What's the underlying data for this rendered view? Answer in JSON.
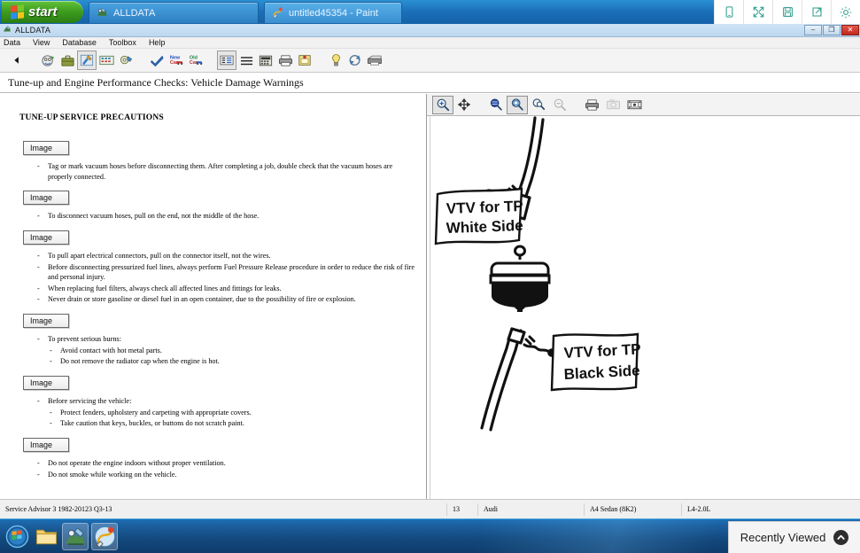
{
  "taskbar_top": {
    "start_label": "start",
    "tasks": [
      {
        "label": "ALLDATA",
        "icon": "alldata-icon"
      },
      {
        "label": "untitled45354 - Paint",
        "icon": "paint-icon"
      }
    ],
    "right_buttons": [
      {
        "name": "device-view-icon"
      },
      {
        "name": "fullscreen-icon"
      },
      {
        "name": "save-icon"
      },
      {
        "name": "share-icon"
      },
      {
        "name": "gear-icon"
      }
    ]
  },
  "app_window": {
    "title": "ALLDATA",
    "window_buttons": {
      "minimize": "–",
      "maximize": "❐",
      "close": "✕"
    },
    "menu": [
      "Data",
      "View",
      "Database",
      "Toolbox",
      "Help"
    ],
    "toolbar": [
      {
        "name": "back-arrow-icon",
        "label": "Back"
      },
      {
        "name": "vehicle-info-icon",
        "label": "Vehicle Info"
      },
      {
        "name": "briefcase-icon",
        "label": "Job"
      },
      {
        "name": "repair-tools-icon",
        "label": "Repair",
        "active": true
      },
      {
        "name": "tsb-icon",
        "label": "TSB"
      },
      {
        "name": "parts-icon",
        "label": "Parts"
      },
      {
        "name": "checkmark-icon",
        "label": "Confirm"
      },
      {
        "name": "new-car-icon",
        "label": "New Car"
      },
      {
        "name": "used-car-icon",
        "label": "Used Car"
      },
      {
        "name": "table-view-icon",
        "label": "Table View",
        "active": true
      },
      {
        "name": "list-view-icon",
        "label": "List View"
      },
      {
        "name": "calculator-icon",
        "label": "Estimator"
      },
      {
        "name": "print-icon",
        "label": "Print"
      },
      {
        "name": "notes-icon",
        "label": "Notes"
      },
      {
        "name": "lightbulb-icon",
        "label": "Tips"
      },
      {
        "name": "refresh-icon",
        "label": "Refresh"
      },
      {
        "name": "fax-icon",
        "label": "Fax"
      }
    ],
    "breadcrumb": "Tune-up and Engine Performance Checks:  Vehicle Damage Warnings"
  },
  "document": {
    "heading": "TUNE-UP SERVICE PRECAUTIONS",
    "image_chip_label": "Image",
    "blocks": [
      {
        "chip": "Image",
        "bullets": [
          "Tag or mark vacuum hoses before disconnecting them. After completing a job, double check that the vacuum hoses are properly connected."
        ]
      },
      {
        "chip": "Image",
        "bullets": [
          "To disconnect vacuum hoses, pull on the end, not the middle of the hose."
        ]
      },
      {
        "chip": "Image",
        "bullets": [
          "To pull apart electrical connectors, pull on the connector itself, not the wires.",
          "Before disconnecting pressurized fuel lines, always perform Fuel Pressure Release procedure in order to reduce the risk of fire and personal injury.",
          "When replacing fuel filters, always check all affected lines and fittings for leaks.",
          "Never drain or store gasoline or diesel fuel in an open container, due to the possibility of fire or explosion."
        ]
      },
      {
        "chip": "Image",
        "bullets": [
          "To prevent serious burns:"
        ],
        "sub_bullets": [
          "Avoid contact with hot metal parts.",
          "Do not remove the radiator cap when the engine is hot."
        ]
      },
      {
        "chip": "Image",
        "bullets": [
          "Before servicing the vehicle:"
        ],
        "sub_bullets": [
          "Protect fenders, upholstery and carpeting with appropriate covers.",
          "Take caution that keys, buckles, or buttons do not scratch paint."
        ]
      },
      {
        "chip": "Image",
        "bullets": [
          "Do not operate the engine indoors without proper ventilation.",
          "Do not smoke while working on the vehicle."
        ]
      }
    ]
  },
  "image_viewer": {
    "toolbar": [
      {
        "name": "zoom-in-icon",
        "active": true
      },
      {
        "name": "pan-icon"
      },
      {
        "name": "zoom-region-icon"
      },
      {
        "name": "zoom-fit-icon",
        "active": true
      },
      {
        "name": "zoom-selection-icon"
      },
      {
        "name": "zoom-out-icon",
        "disabled": true
      },
      {
        "name": "print-image-icon"
      },
      {
        "name": "camera-icon",
        "disabled": true
      },
      {
        "name": "filmstrip-icon"
      }
    ],
    "diagram": {
      "label_top_line1": "VTV for TP",
      "label_top_line2": "White Side",
      "label_bottom_line1": "VTV for TP",
      "label_bottom_line2": "Black Side"
    }
  },
  "status_bar": {
    "version": "Service Advisor 3 1982-20123 Q3-13",
    "year": "13",
    "make": "Audi",
    "model": "A4 Sedan (8K2)",
    "engine": "L4-2.0L"
  },
  "desktop_taskbar": {
    "icons": [
      {
        "name": "start-orb-icon"
      },
      {
        "name": "explorer-folder-icon"
      },
      {
        "name": "alldata-taskbar-icon",
        "active": true
      },
      {
        "name": "paint-taskbar-icon",
        "active": true
      }
    ]
  },
  "recently_viewed": {
    "label": "Recently Viewed",
    "chevron": "▲"
  },
  "colors": {
    "taskbar_blue": "#1a6fb8",
    "start_green": "#3f9e20",
    "accent_teal": "#2f9e8f"
  }
}
